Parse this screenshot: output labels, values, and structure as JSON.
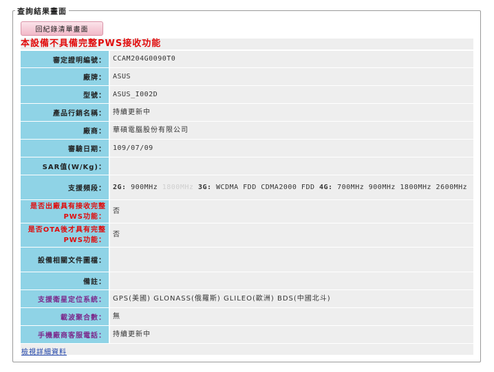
{
  "legend": "查詢結果畫面",
  "back_button": "回紀錄清單畫面",
  "warning": "本設備不具備完整PWS接收功能",
  "rows": {
    "cert_no": {
      "label": "審定證明編號：",
      "value": "CCAM204G0090T0"
    },
    "brand": {
      "label": "廠牌：",
      "value": "ASUS"
    },
    "model": {
      "label": "型號：",
      "value": "ASUS_I002D"
    },
    "product_name": {
      "label": "產品行銷名稱：",
      "value": "持續更新中"
    },
    "maker": {
      "label": "廠商：",
      "value": "華碩電腦股份有限公司"
    },
    "approval_date": {
      "label": "審驗日期：",
      "value": "109/07/09"
    },
    "sar": {
      "label": "SAR值(W/Kg)：",
      "value": ""
    },
    "bands": {
      "label": "支援頻段：",
      "g2_label": "2G:",
      "g2_value": "900MHz",
      "g2_gray": "1800MHz",
      "g3_label": "3G:",
      "g3_value": "WCDMA FDD CDMA2000 FDD",
      "g4_label": "4G:",
      "g4_value": "700MHz 900MHz 1800MHz 2600MHz"
    },
    "pws_factory": {
      "label_line1": "是否出廠具有接收完整",
      "label_line2": "PWS功能：",
      "value": "否"
    },
    "pws_ota": {
      "label_line1": "是否OTA後才具有完整",
      "label_line2": "PWS功能：",
      "value": "否"
    },
    "docs": {
      "label": "設備相關文件圖檔：",
      "value": ""
    },
    "remarks": {
      "label": "備註：",
      "value": ""
    },
    "gnss": {
      "label": "支援衛星定位系統：",
      "value": "GPS(美國) GLONASS(俄羅斯) GLILEO(歐洲) BDS(中國北斗)"
    },
    "carrier_agg": {
      "label": "載波聚合數：",
      "value": "無"
    },
    "service_phone": {
      "label": "手機廠商客服電話：",
      "value": "持續更新中"
    }
  },
  "detail_link": "檢視詳細資料"
}
